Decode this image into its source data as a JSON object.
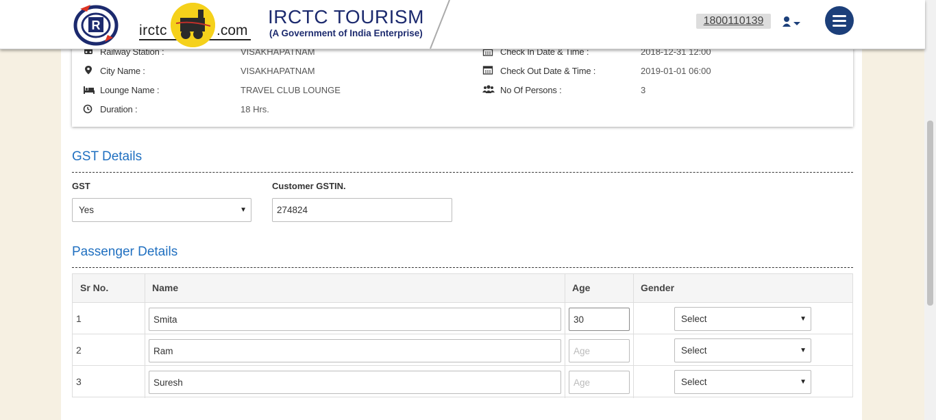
{
  "header": {
    "brand_left": "irctc",
    "brand_right": ".com",
    "title": "IRCTC TOURISM",
    "subtitle": "(A Government of India Enterprise)",
    "phone": "1800110139"
  },
  "summary": {
    "railway_station_label": "Railway Station :",
    "railway_station_value": "VISAKHAPATNAM",
    "city_label": "City Name :",
    "city_value": "VISAKHAPATNAM",
    "lounge_label": "Lounge Name :",
    "lounge_value": "TRAVEL CLUB LOUNGE",
    "duration_label": "Duration :",
    "duration_value": "18 Hrs.",
    "checkin_label": "Check In Date & Time :",
    "checkin_value": "2018-12-31 12:00",
    "checkout_label": "Check Out Date & Time :",
    "checkout_value": "2019-01-01 06:00",
    "persons_label": "No Of Persons :",
    "persons_value": "3"
  },
  "gst": {
    "section_title": "GST Details",
    "gst_label": "GST",
    "gst_value": "Yes",
    "gstin_label": "Customer GSTIN.",
    "gstin_value": "274824"
  },
  "passengers": {
    "section_title": "Passenger Details",
    "headers": {
      "sr": "Sr No.",
      "name": "Name",
      "age": "Age",
      "gender": "Gender"
    },
    "age_placeholder": "Age",
    "rows": [
      {
        "sr": "1",
        "name": "Smita",
        "age": "30",
        "gender": "Select"
      },
      {
        "sr": "2",
        "name": "Ram",
        "age": "",
        "gender": "Select"
      },
      {
        "sr": "3",
        "name": "Suresh",
        "age": "",
        "gender": "Select"
      }
    ]
  }
}
